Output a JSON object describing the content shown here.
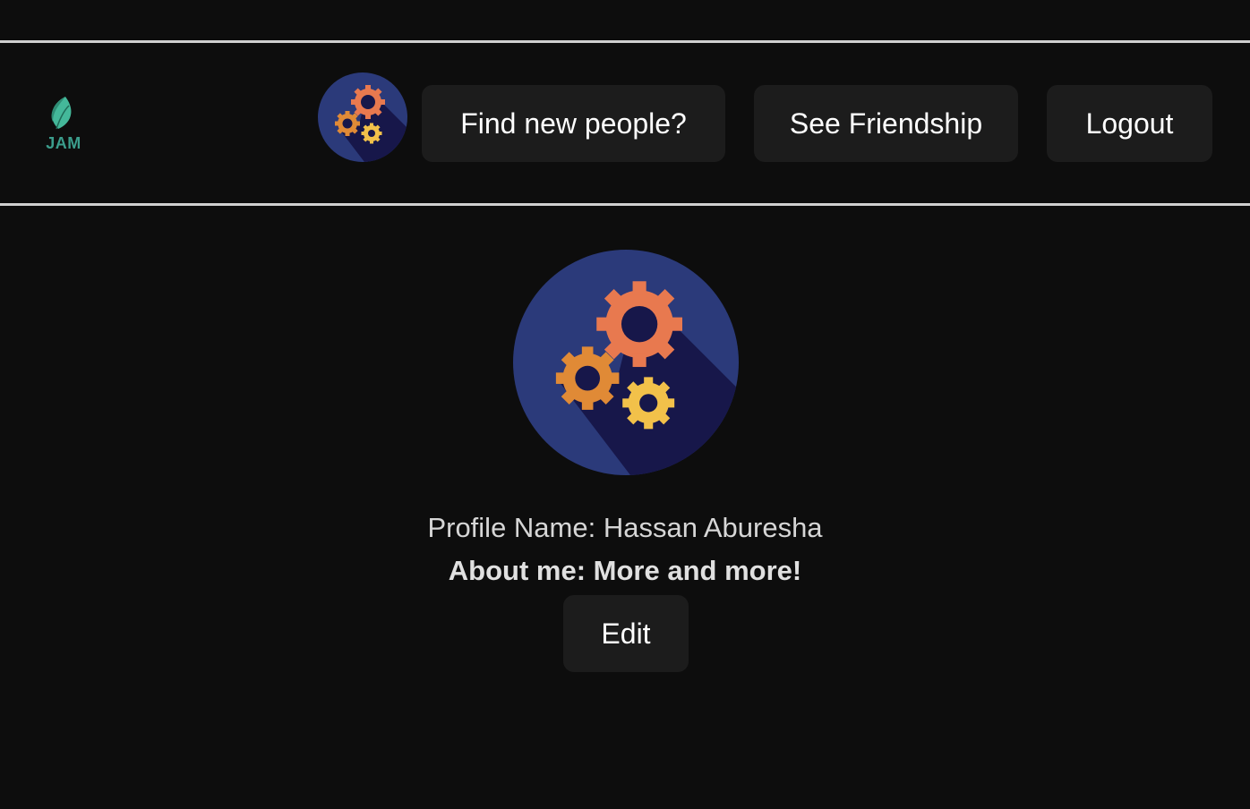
{
  "header": {
    "logo": {
      "text": "JAM",
      "icon": "leaf-icon",
      "color": "#3b9d8c"
    },
    "avatar": {
      "icon": "gears-icon"
    },
    "nav": {
      "find_label": "Find new people?",
      "friendship_label": "See Friendship",
      "logout_label": "Logout"
    }
  },
  "profile": {
    "avatar": {
      "icon": "gears-icon"
    },
    "name_line": "Profile Name: Hassan Aburesha",
    "about_line": "About me: More and more!",
    "edit_label": "Edit"
  },
  "colors": {
    "background": "#0d0d0d",
    "button": "#1c1c1c",
    "avatar_bg": "#2b3a7a",
    "gear_orange": "#e8794f",
    "gear_gold": "#f2c14a",
    "gear_amber": "#e08a36"
  }
}
